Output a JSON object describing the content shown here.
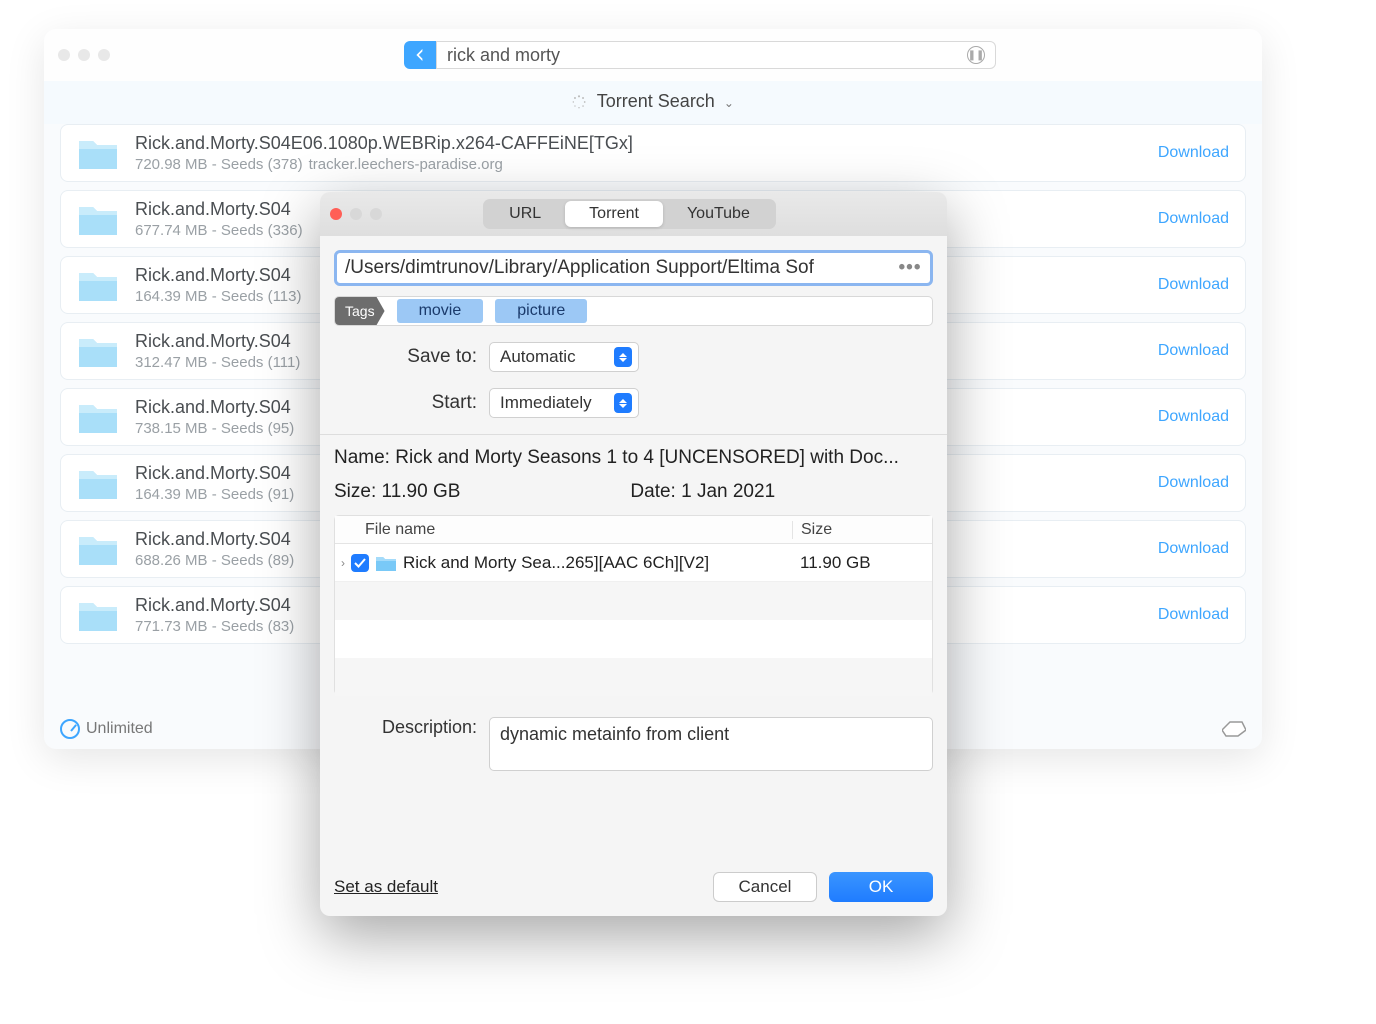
{
  "search": {
    "query": "rick and morty"
  },
  "section_title": "Torrent Search",
  "download_label": "Download",
  "status": {
    "speed": "Unlimited"
  },
  "results": [
    {
      "title": "Rick.and.Morty.S04E06.1080p.WEBRip.x264-CAFFEiNE[TGx]",
      "meta": "720.98 MB - Seeds (378)",
      "tracker": "tracker.leechers-paradise.org"
    },
    {
      "title": "Rick.and.Morty.S04",
      "meta": "677.74 MB - Seeds (336)",
      "tracker": ""
    },
    {
      "title": "Rick.and.Morty.S04",
      "meta": "164.39 MB - Seeds (113)",
      "tracker": ""
    },
    {
      "title": "Rick.and.Morty.S04",
      "meta": "312.47 MB - Seeds (111)",
      "tracker": ""
    },
    {
      "title": "Rick.and.Morty.S04",
      "meta": "738.15 MB - Seeds (95)",
      "tracker": ""
    },
    {
      "title": "Rick.and.Morty.S04",
      "meta": "164.39 MB - Seeds (91)",
      "tracker": ""
    },
    {
      "title": "Rick.and.Morty.S04",
      "meta": "688.26 MB - Seeds (89)",
      "tracker": ""
    },
    {
      "title": "Rick.and.Morty.S04",
      "meta": "771.73 MB - Seeds (83)",
      "tracker": ""
    }
  ],
  "dialog": {
    "tabs": {
      "url": "URL",
      "torrent": "Torrent",
      "youtube": "YouTube",
      "active": "torrent"
    },
    "path": "/Users/dimtrunov/Library/Application Support/Eltima Sof",
    "tags_label": "Tags",
    "tags": [
      "movie",
      "picture"
    ],
    "save_to_label": "Save to:",
    "save_to_value": "Automatic",
    "start_label": "Start:",
    "start_value": "Immediately",
    "name_label": "Name:",
    "name_value": "Rick and Morty Seasons 1 to 4 [UNCENSORED] with Doc...",
    "size_label": "Size:",
    "size_value": "11.90 GB",
    "date_label": "Date:",
    "date_value": "1 Jan 2021",
    "table": {
      "col_file": "File name",
      "col_size": "Size",
      "rows": [
        {
          "name": "Rick and Morty Sea...265][AAC 6Ch][V2]",
          "size": "11.90 GB"
        }
      ]
    },
    "desc_label": "Description:",
    "desc_value": "dynamic metainfo from client",
    "set_default": "Set as default",
    "cancel": "Cancel",
    "ok": "OK"
  },
  "truncated_suffix": "Gx]"
}
